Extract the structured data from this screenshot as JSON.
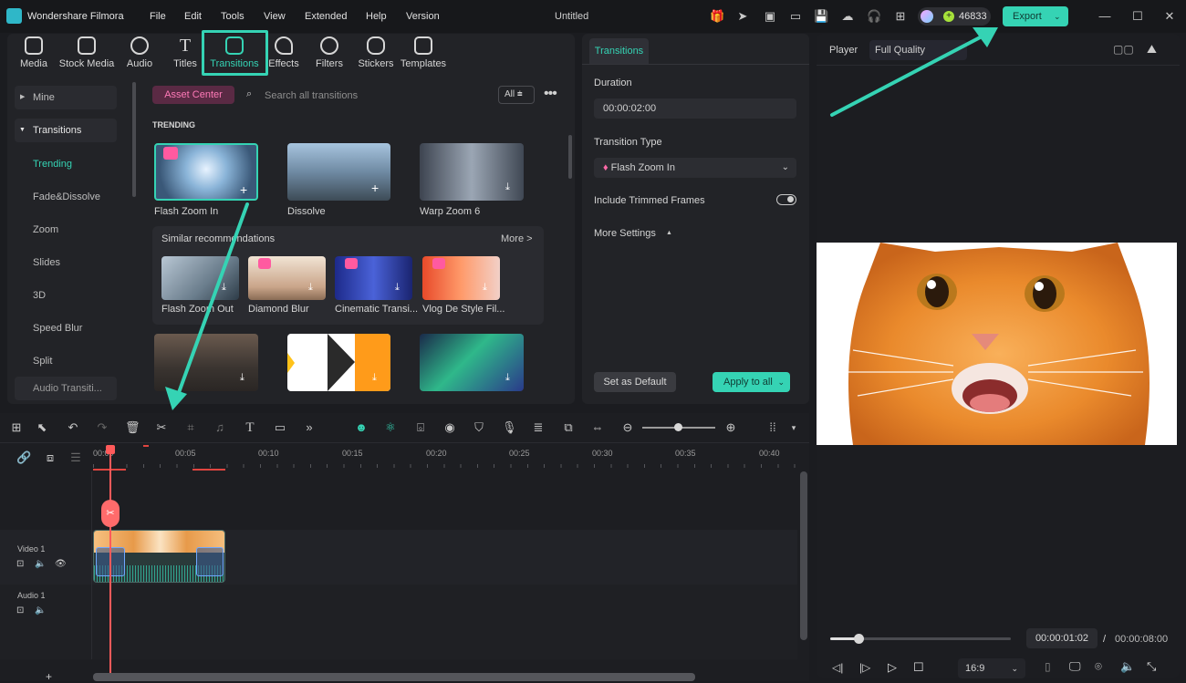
{
  "app": {
    "name": "Wondershare Filmora",
    "doc_title": "Untitled",
    "credits": "46833",
    "export_label": "Export"
  },
  "menu": [
    "File",
    "Edit",
    "Tools",
    "View",
    "Extended",
    "Help",
    "Version"
  ],
  "toolbar": [
    "Media",
    "Stock Media",
    "Audio",
    "Titles",
    "Transitions",
    "Effects",
    "Filters",
    "Stickers",
    "Templates"
  ],
  "sidebar": {
    "mine": "Mine",
    "transitions": "Transitions",
    "items": [
      "Trending",
      "Fade&Dissolve",
      "Zoom",
      "Slides",
      "3D",
      "Speed Blur",
      "Split",
      "Audio Transiti..."
    ]
  },
  "browser": {
    "asset_center": "Asset Center",
    "search_placeholder": "Search all transitions",
    "filter": "All",
    "section": "TRENDING",
    "trending": [
      "Flash Zoom In",
      "Dissolve",
      "Warp Zoom 6"
    ],
    "similar_title": "Similar recommendations",
    "more": "More >",
    "similar": [
      "Flash Zoom Out",
      "Diamond Blur",
      "Cinematic Transi...",
      "Vlog De Style Fil..."
    ]
  },
  "props": {
    "tab": "Transitions",
    "duration_label": "Duration",
    "duration_value": "00:00:02:00",
    "type_label": "Transition Type",
    "type_value": "Flash Zoom In",
    "trimmed_label": "Include Trimmed Frames",
    "more_settings": "More Settings",
    "set_default": "Set as Default",
    "apply_all": "Apply to all"
  },
  "player": {
    "label": "Player",
    "quality": "Full Quality",
    "current_time": "00:00:01:02",
    "separator": "/",
    "total_time": "00:00:08:00",
    "aspect": "16:9"
  },
  "timeline": {
    "ticks": [
      "00:00",
      "00:05",
      "00:10",
      "00:15",
      "00:20",
      "00:25",
      "00:30",
      "00:35",
      "00:40"
    ],
    "tracks": [
      "Video 1",
      "Audio 1"
    ]
  },
  "colors": {
    "accent": "#35d3b4",
    "playhead": "#ff5a5a",
    "bg": "#1b1c20",
    "panel": "#222327"
  }
}
